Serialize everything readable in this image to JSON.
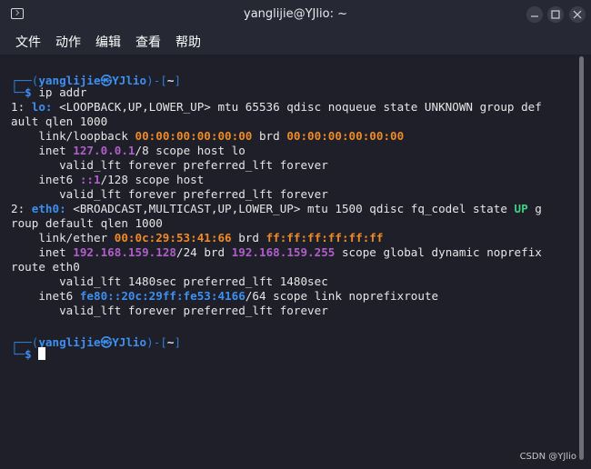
{
  "window": {
    "title": "yanglijie@YJlio: ~"
  },
  "menu": {
    "items": [
      "文件",
      "动作",
      "编辑",
      "查看",
      "帮助"
    ]
  },
  "prompt": {
    "frame_top": "┌──(",
    "user": "yanglijie",
    "at": "㉿",
    "host": "YJlio",
    "mid": ")-[",
    "dir": "~",
    "end": "]",
    "frame_bottom": "└─",
    "symbol": "$",
    "command": " ip addr"
  },
  "output": {
    "l1_num": "1: ",
    "l1_iface": "lo:",
    "l1_rest": " <LOOPBACK,UP,LOWER_UP> mtu 65536 qdisc noqueue state UNKNOWN group def",
    "l2": "ault qlen 1000",
    "l3_a": "    link/loopback ",
    "l3_mac": "00:00:00:00:00:00",
    "l3_b": " brd ",
    "l3_brd": "00:00:00:00:00:00",
    "l4_a": "    inet ",
    "l4_ip": "127.0.0.1",
    "l4_b": "/8 scope host lo",
    "l5": "       valid_lft forever preferred_lft forever",
    "l6_a": "    inet6 ",
    "l6_ip": "::1",
    "l6_b": "/128 scope host",
    "l7": "       valid_lft forever preferred_lft forever",
    "l8_num": "2: ",
    "l8_iface": "eth0:",
    "l8_a": " <BROADCAST,MULTICAST,UP,LOWER_UP> mtu 1500 qdisc fq_codel state ",
    "l8_state": "UP",
    "l8_b": " g",
    "l9": "roup default qlen 1000",
    "l10_a": "    link/ether ",
    "l10_mac": "00:0c:29:53:41:66",
    "l10_b": " brd ",
    "l10_brd": "ff:ff:ff:ff:ff:ff",
    "l11_a": "    inet ",
    "l11_ip": "192.168.159.128",
    "l11_b": "/24 brd ",
    "l11_brd": "192.168.159.255",
    "l11_c": " scope global dynamic noprefix",
    "l12": "route eth0",
    "l13": "       valid_lft 1480sec preferred_lft 1480sec",
    "l14_a": "    inet6 ",
    "l14_ip": "fe80::20c:29ff:fe53:4166",
    "l14_b": "/64 scope link noprefixroute",
    "l15": "       valid_lft forever preferred_lft forever"
  },
  "watermark": "CSDN @YJlio",
  "colors": {
    "background": "#1e1f29",
    "prompt_blue": "#3d8ff0",
    "mac_orange": "#f08a24",
    "ip_purple": "#b05ec8",
    "state_green": "#3fd17f"
  }
}
